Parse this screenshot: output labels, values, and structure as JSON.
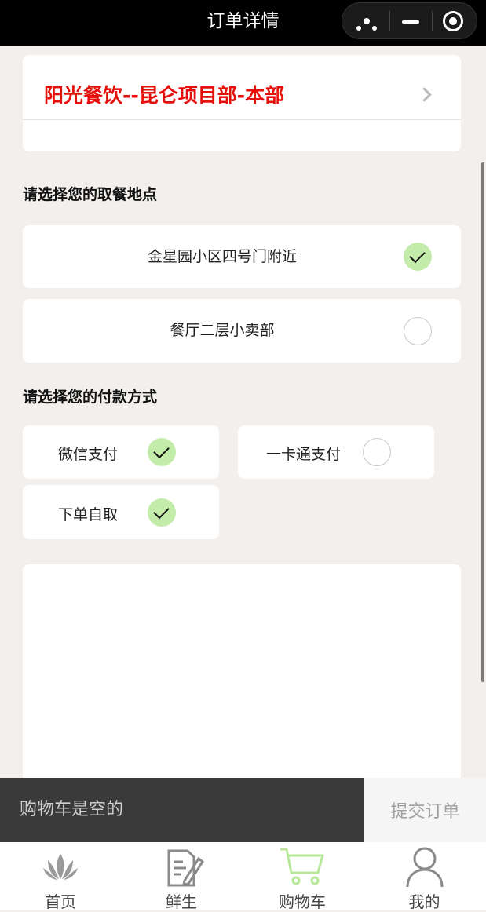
{
  "header": {
    "title": "订单详情",
    "menu_icon": "more-dots-icon",
    "minimize_icon": "minimize-icon",
    "close_icon": "target-icon"
  },
  "store": {
    "name": "阳光餐饮--昆仑项目部-本部",
    "name_color": "#e5100b"
  },
  "pickup": {
    "title": "请选择您的取餐地点",
    "options": [
      {
        "label": "金星园小区四号门附近",
        "selected": true
      },
      {
        "label": "餐厅二层小卖部",
        "selected": false
      }
    ]
  },
  "payment": {
    "title": "请选择您的付款方式",
    "options": [
      {
        "label": "微信支付",
        "selected": true
      },
      {
        "label": "一卡通支付",
        "selected": false
      },
      {
        "label": "下单自取",
        "selected": true
      }
    ]
  },
  "cart": {
    "empty_text": "购物车是空的",
    "submit_label": "提交订单"
  },
  "tabbar": {
    "items": [
      {
        "label": "首页",
        "icon": "lotus-icon"
      },
      {
        "label": "鲜生",
        "icon": "document-edit-icon"
      },
      {
        "label": "购物车",
        "icon": "cart-icon",
        "active": true
      },
      {
        "label": "我的",
        "icon": "user-icon"
      }
    ]
  },
  "colors": {
    "check_selected": "#c3ebaa",
    "accent_green": "#b7e89a",
    "page_bg": "#f2efec"
  }
}
